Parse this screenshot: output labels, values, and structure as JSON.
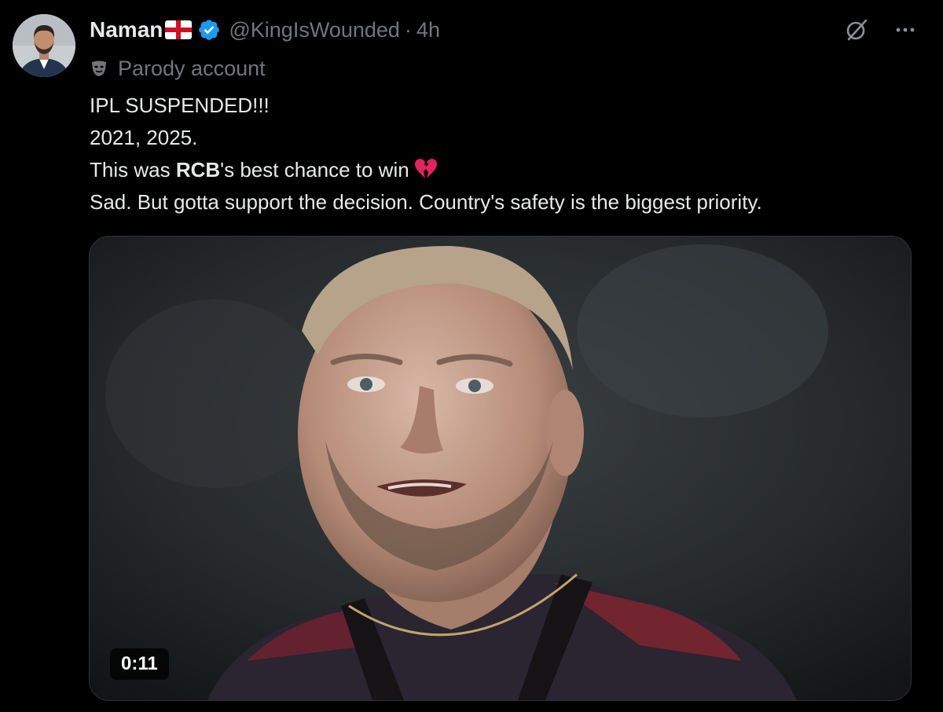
{
  "author": {
    "display_name": "Naman",
    "handle": "@KingIsWounded",
    "separator": "·",
    "time": "4h",
    "flag_icon": "england-flag-icon",
    "verified_icon": "verified-badge-icon",
    "label": "Parody account",
    "label_icon": "parody-mask-icon"
  },
  "tweet": {
    "line1": "IPL SUSPENDED!!!",
    "line2": "2021, 2025.",
    "line3_prefix": "This was ",
    "line3_bold": "RCB",
    "line3_suffix": "'s best chance to win",
    "line3_emoji": "broken-heart-icon",
    "line4": "Sad. But gotta support the decision. Country's safety is the biggest priority."
  },
  "media": {
    "type": "video",
    "duration": "0:11"
  },
  "actions": {
    "grok_icon": "grok-icon",
    "more_icon": "more-icon"
  },
  "colors": {
    "background": "#000000",
    "text": "#e7e9ea",
    "secondary": "#71767b",
    "verified": "#1d9bf0",
    "heart": "#e0245e"
  }
}
